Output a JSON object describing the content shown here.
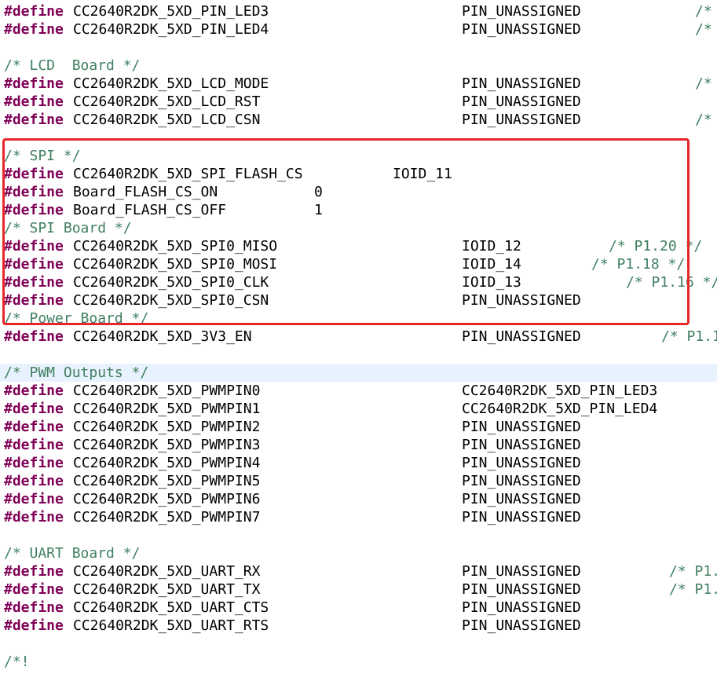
{
  "editor": {
    "highlight_color": "#e8262a",
    "keyword_color": "#7f0055",
    "comment_color": "#3f7f5f",
    "current_line_color": "#e8f2fe",
    "lines": [
      {
        "kw": "#define",
        "name": "CC2640R2DK_5XD_PIN_LED3",
        "value": "PIN_UNASSIGNED",
        "comment": "/*"
      },
      {
        "kw": "#define",
        "name": "CC2640R2DK_5XD_PIN_LED4",
        "value": "PIN_UNASSIGNED",
        "comment": "/*"
      },
      {
        "blank": true
      },
      {
        "comment": "/* LCD  Board */"
      },
      {
        "kw": "#define",
        "name": "CC2640R2DK_5XD_LCD_MODE",
        "value": "PIN_UNASSIGNED",
        "comment": "/*"
      },
      {
        "kw": "#define",
        "name": "CC2640R2DK_5XD_LCD_RST",
        "value": "PIN_UNASSIGNED"
      },
      {
        "kw": "#define",
        "name": "CC2640R2DK_5XD_LCD_CSN",
        "value": "PIN_UNASSIGNED",
        "comment": "/*"
      },
      {
        "blank": true
      },
      {
        "comment": "/* SPI */"
      },
      {
        "kw": "#define",
        "name": "CC2640R2DK_5XD_SPI_FLASH_CS",
        "value": "IOID_11"
      },
      {
        "kw": "#define",
        "name": "Board_FLASH_CS_ON",
        "value": "0"
      },
      {
        "kw": "#define",
        "name": "Board_FLASH_CS_OFF",
        "value": "1"
      },
      {
        "comment": "/* SPI Board */"
      },
      {
        "kw": "#define",
        "name": "CC2640R2DK_5XD_SPI0_MISO",
        "value": "IOID_12",
        "comment": "/* P1.20 */"
      },
      {
        "kw": "#define",
        "name": "CC2640R2DK_5XD_SPI0_MOSI",
        "value": "IOID_14",
        "comment": "/* P1.18 */"
      },
      {
        "kw": "#define",
        "name": "CC2640R2DK_5XD_SPI0_CLK",
        "value": "IOID_13",
        "comment": "/* P1.16 */"
      },
      {
        "kw": "#define",
        "name": "CC2640R2DK_5XD_SPI0_CSN",
        "value": "PIN_UNASSIGNED"
      },
      {
        "comment": "/* Power Board */"
      },
      {
        "kw": "#define",
        "name": "CC2640R2DK_5XD_3V3_EN",
        "value": "PIN_UNASSIGNED",
        "comment": "/* P1.1"
      },
      {
        "blank": true
      },
      {
        "comment": "/* PWM Outputs */",
        "current": true
      },
      {
        "kw": "#define",
        "name": "CC2640R2DK_5XD_PWMPIN0",
        "value": "CC2640R2DK_5XD_PIN_LED3"
      },
      {
        "kw": "#define",
        "name": "CC2640R2DK_5XD_PWMPIN1",
        "value": "CC2640R2DK_5XD_PIN_LED4"
      },
      {
        "kw": "#define",
        "name": "CC2640R2DK_5XD_PWMPIN2",
        "value": "PIN_UNASSIGNED"
      },
      {
        "kw": "#define",
        "name": "CC2640R2DK_5XD_PWMPIN3",
        "value": "PIN_UNASSIGNED"
      },
      {
        "kw": "#define",
        "name": "CC2640R2DK_5XD_PWMPIN4",
        "value": "PIN_UNASSIGNED"
      },
      {
        "kw": "#define",
        "name": "CC2640R2DK_5XD_PWMPIN5",
        "value": "PIN_UNASSIGNED"
      },
      {
        "kw": "#define",
        "name": "CC2640R2DK_5XD_PWMPIN6",
        "value": "PIN_UNASSIGNED"
      },
      {
        "kw": "#define",
        "name": "CC2640R2DK_5XD_PWMPIN7",
        "value": "PIN_UNASSIGNED"
      },
      {
        "blank": true
      },
      {
        "comment": "/* UART Board */"
      },
      {
        "kw": "#define",
        "name": "CC2640R2DK_5XD_UART_RX",
        "value": "PIN_UNASSIGNED",
        "comment": "/* P1."
      },
      {
        "kw": "#define",
        "name": "CC2640R2DK_5XD_UART_TX",
        "value": "PIN_UNASSIGNED",
        "comment": "/* P1."
      },
      {
        "kw": "#define",
        "name": "CC2640R2DK_5XD_UART_CTS",
        "value": "PIN_UNASSIGNED"
      },
      {
        "kw": "#define",
        "name": "CC2640R2DK_5XD_UART_RTS",
        "value": "PIN_UNASSIGNED"
      },
      {
        "blank": true
      },
      {
        "comment": "/*!"
      }
    ]
  }
}
